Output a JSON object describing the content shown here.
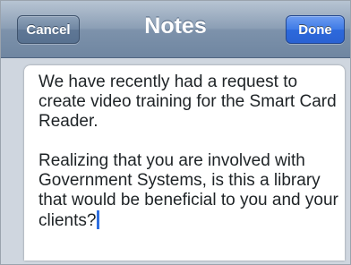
{
  "navbar": {
    "title": "Notes",
    "cancel_label": "Cancel",
    "done_label": "Done"
  },
  "note": {
    "paragraph1": "We have recently had a request to create video training for the Smart Card Reader.",
    "paragraph2": "Realizing that you are involved with Government Systems, is this a library that would be beneficial to you and your clients?"
  },
  "colors": {
    "navbar": "#8c9fb5",
    "done_button": "#2d69dc",
    "caret": "#2f6fe0",
    "text": "#1e2326"
  }
}
